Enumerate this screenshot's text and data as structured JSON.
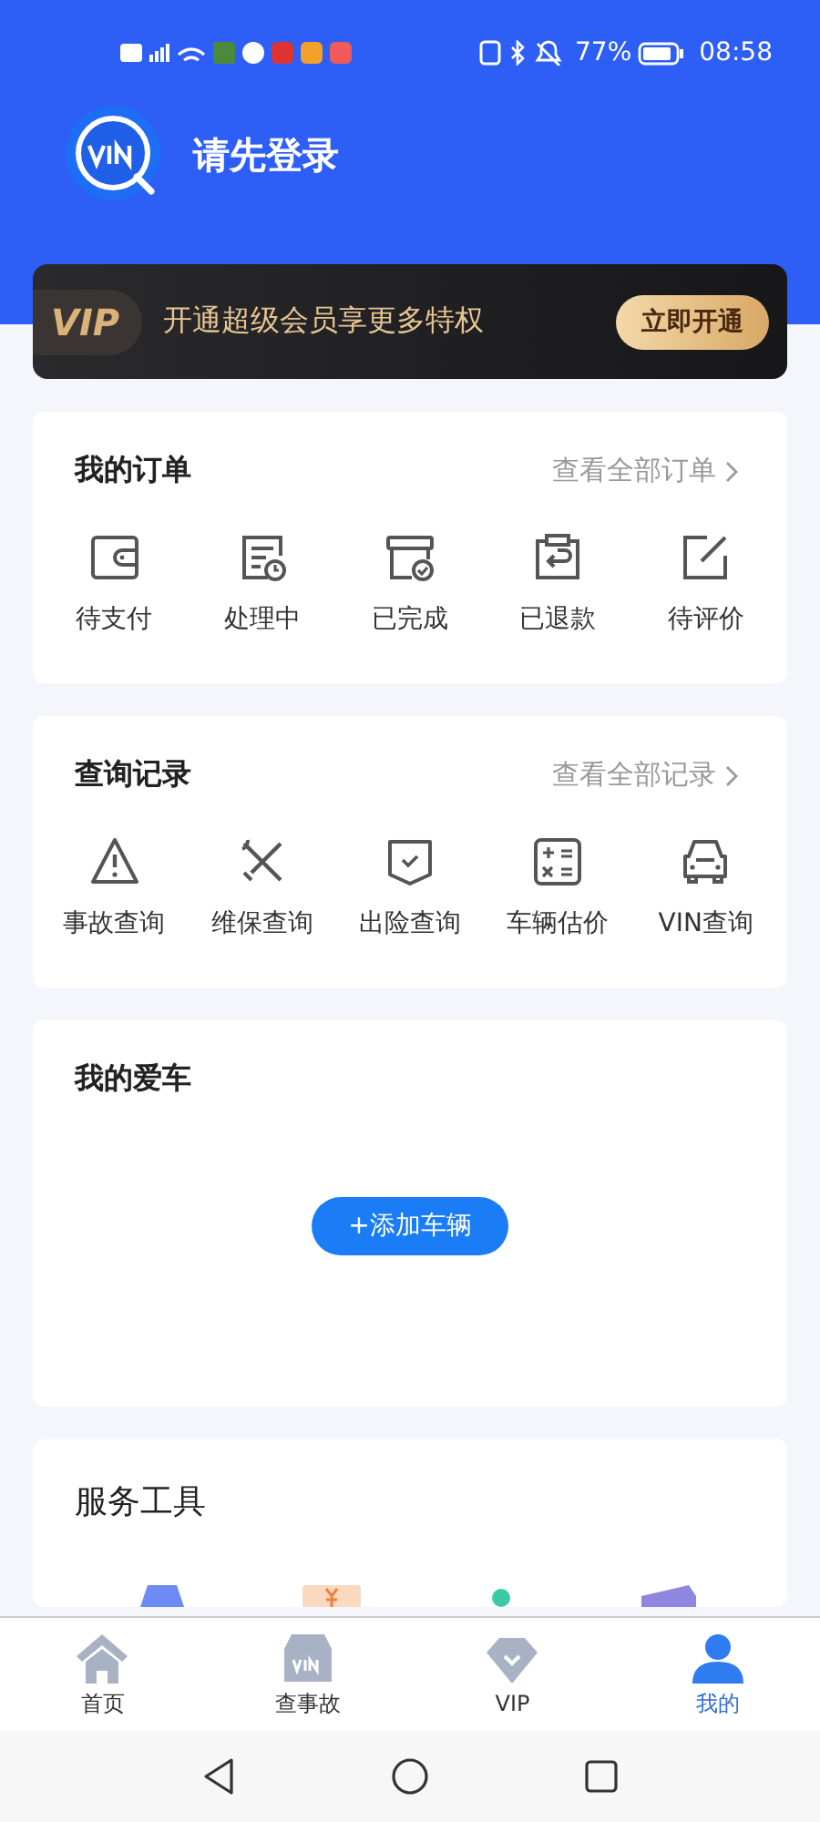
{
  "status_bar": {
    "battery": "77%",
    "time": "08:58"
  },
  "header": {
    "login_text": "请先登录"
  },
  "vip_banner": {
    "badge": "VIP",
    "text": "开通超级会员享更多特权",
    "button": "立即开通"
  },
  "orders": {
    "title": "我的订单",
    "link": "查看全部订单",
    "items": [
      {
        "kind": "wallet",
        "label": "待支付"
      },
      {
        "kind": "processing",
        "label": "处理中"
      },
      {
        "kind": "done",
        "label": "已完成"
      },
      {
        "kind": "refund",
        "label": "已退款"
      },
      {
        "kind": "review",
        "label": "待评价"
      }
    ]
  },
  "records": {
    "title": "查询记录",
    "link": "查看全部记录",
    "items": [
      {
        "kind": "warning",
        "label": "事故查询"
      },
      {
        "kind": "tools",
        "label": "维保查询"
      },
      {
        "kind": "shield",
        "label": "出险查询"
      },
      {
        "kind": "calculator",
        "label": "车辆估价"
      },
      {
        "kind": "car",
        "label": "VIN查询"
      }
    ]
  },
  "my_car": {
    "title": "我的爱车",
    "button": "+添加车辆"
  },
  "service_tools": {
    "title": "服务工具"
  },
  "tab_bar": [
    {
      "kind": "home",
      "label": "首页",
      "selected": false
    },
    {
      "kind": "vin",
      "label": "查事故",
      "selected": false
    },
    {
      "kind": "vip",
      "label": "VIP",
      "selected": false
    },
    {
      "kind": "user",
      "label": "我的",
      "selected": true
    }
  ]
}
